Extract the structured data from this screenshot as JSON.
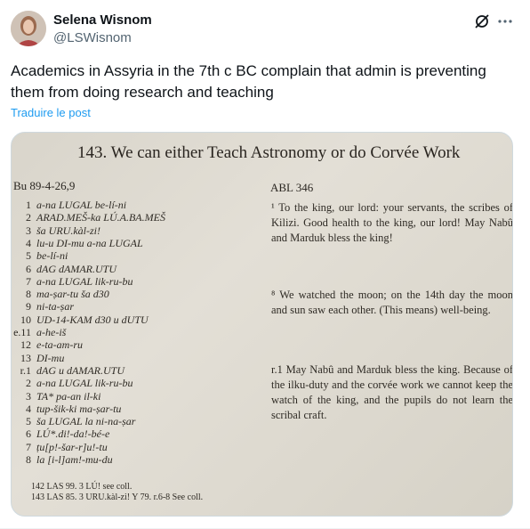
{
  "author": {
    "name": "Selena Wisnom",
    "handle": "@LSWisnom"
  },
  "tweet": {
    "text": "Academics in Assyria in the 7th c BC complain that admin is preventing them from doing research and teaching",
    "translate_label": "Traduire le post"
  },
  "icons": {
    "grok": "grok-icon",
    "more": "more-icon"
  },
  "image": {
    "title": "143. We can either Teach Astronomy or do Corvée Work",
    "left_head": "Bu 89-4-26,9",
    "right_head": "ABL 346",
    "lines": [
      {
        "num": "1",
        "text": "a-na LUGAL be-lí-ni"
      },
      {
        "num": "2",
        "text": "ARAD.MEŠ-ka LÚ.A.BA.MEŠ"
      },
      {
        "num": "3",
        "text": "ša URU.kàl-zi!"
      },
      {
        "num": "4",
        "text": "lu-u DI-mu a-na LUGAL"
      },
      {
        "num": "5",
        "text": "be-lí-ni"
      },
      {
        "num": "6",
        "text": "dAG dAMAR.UTU"
      },
      {
        "num": "7",
        "text": "a-na LUGAL lik-ru-bu"
      },
      {
        "num": "8",
        "text": "ma-ṣar-tu ša d30"
      },
      {
        "num": "9",
        "text": "ni-ta-ṣar"
      },
      {
        "num": "10",
        "text": "UD-14-KAM d30 u dUTU"
      },
      {
        "num": "e.11",
        "text": "a-he-iš"
      },
      {
        "num": "12",
        "text": "e-ta-am-ru"
      },
      {
        "num": "13",
        "text": "DI-mu"
      },
      {
        "num": "r.1",
        "text": "dAG u dAMAR.UTU"
      },
      {
        "num": "2",
        "text": "a-na LUGAL lik-ru-bu"
      },
      {
        "num": "3",
        "text": "TA* pa-an il-ki"
      },
      {
        "num": "4",
        "text": "tup-šik-ki ma-ṣar-tu"
      },
      {
        "num": "5",
        "text": "ša LUGAL la ni-na-ṣar"
      },
      {
        "num": "6",
        "text": "LÚ*.di!-da!-bé-e"
      },
      {
        "num": "7",
        "text": "ṭu[p!-šar-r]u!-tu"
      },
      {
        "num": "8",
        "text": "la [i-l]am!-mu-du"
      }
    ],
    "translation": [
      "¹ To the king, our lord: your servants, the scribes of Kilizi. Good health to the king, our lord! May Nabû and Marduk bless the king!",
      "⁸ We watched the moon; on the 14th day the moon and sun saw each other. (This means) well-being.",
      "r.1 May Nabû and Marduk bless the king. Because of the ilku-duty and the corvée work we cannot keep the watch of the king, and the pupils do not learn the scribal craft."
    ],
    "footnotes": {
      "line1": "142  LAS 99.     3 LÚ! see coll.",
      "line2": "143  LAS 85.     3 URU.kàl-zi! Y 79.     r.6-8 See coll."
    }
  }
}
